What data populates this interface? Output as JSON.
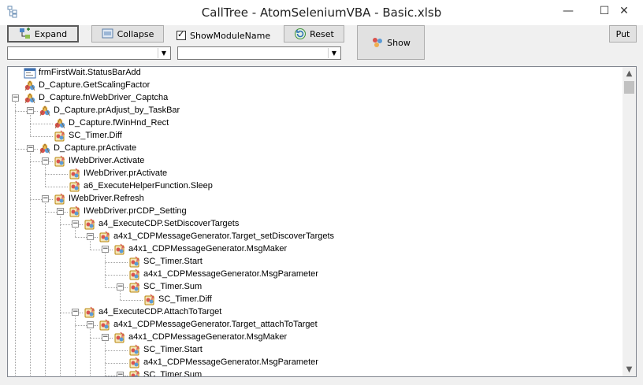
{
  "window": {
    "title": "CallTree - AtomSeleniumVBA - Basic.xlsb",
    "minimize": "—",
    "maximize": "☐",
    "close": "✕"
  },
  "toolbar": {
    "expand_label": "Expand",
    "collapse_label": "Collapse",
    "show_module_name_label": "ShowModuleName",
    "show_module_name_checked": true,
    "reset_label": "Reset",
    "show_label": "Show",
    "put_label": "Put",
    "combo1_value": "",
    "combo2_value": ""
  },
  "icons": {
    "app": "tree-view-icon",
    "expand": "expand-tree-icon",
    "collapse": "collapse-tree-icon",
    "reset": "reset-icon",
    "show": "modules-icon",
    "form_node": "form-icon",
    "module_node": "module-icon",
    "class_node": "class-module-icon"
  },
  "tree": {
    "nodes": [
      {
        "label": "frmFirstWait.StatusBarAdd",
        "depth": 0,
        "icon": "form",
        "expander": "none"
      },
      {
        "label": "D_Capture.GetScalingFactor",
        "depth": 0,
        "icon": "module",
        "expander": "none"
      },
      {
        "label": "D_Capture.fnWebDriver_Captcha",
        "depth": 0,
        "icon": "module",
        "expander": "minus"
      },
      {
        "label": "D_Capture.prAdjust_by_TaskBar",
        "depth": 1,
        "icon": "module",
        "expander": "minus"
      },
      {
        "label": "D_Capture.fWinHnd_Rect",
        "depth": 2,
        "icon": "module",
        "expander": "none"
      },
      {
        "label": "SC_Timer.Diff",
        "depth": 2,
        "icon": "class",
        "expander": "none"
      },
      {
        "label": "D_Capture.prActivate",
        "depth": 1,
        "icon": "module",
        "expander": "minus"
      },
      {
        "label": "IWebDriver.Activate",
        "depth": 2,
        "icon": "class",
        "expander": "minus"
      },
      {
        "label": "IWebDriver.prActivate",
        "depth": 3,
        "icon": "class",
        "expander": "none"
      },
      {
        "label": "a6_ExecuteHelperFunction.Sleep",
        "depth": 3,
        "icon": "class",
        "expander": "none"
      },
      {
        "label": "IWebDriver.Refresh",
        "depth": 2,
        "icon": "class",
        "expander": "minus"
      },
      {
        "label": "IWebDriver.prCDP_Setting",
        "depth": 3,
        "icon": "class",
        "expander": "minus"
      },
      {
        "label": "a4_ExecuteCDP.SetDiscoverTargets",
        "depth": 4,
        "icon": "class",
        "expander": "minus"
      },
      {
        "label": "a4x1_CDPMessageGenerator.Target_setDiscoverTargets",
        "depth": 5,
        "icon": "class",
        "expander": "minus"
      },
      {
        "label": "a4x1_CDPMessageGenerator.MsgMaker",
        "depth": 6,
        "icon": "class",
        "expander": "minus"
      },
      {
        "label": "SC_Timer.Start",
        "depth": 7,
        "icon": "class",
        "expander": "none"
      },
      {
        "label": "a4x1_CDPMessageGenerator.MsgParameter",
        "depth": 7,
        "icon": "class",
        "expander": "none"
      },
      {
        "label": "SC_Timer.Sum",
        "depth": 7,
        "icon": "class",
        "expander": "minus"
      },
      {
        "label": "SC_Timer.Diff",
        "depth": 8,
        "icon": "class",
        "expander": "none"
      },
      {
        "label": "a4_ExecuteCDP.AttachToTarget",
        "depth": 4,
        "icon": "class",
        "expander": "minus"
      },
      {
        "label": "a4x1_CDPMessageGenerator.Target_attachToTarget",
        "depth": 5,
        "icon": "class",
        "expander": "minus"
      },
      {
        "label": "a4x1_CDPMessageGenerator.MsgMaker",
        "depth": 6,
        "icon": "class",
        "expander": "minus"
      },
      {
        "label": "SC_Timer.Start",
        "depth": 7,
        "icon": "class",
        "expander": "none"
      },
      {
        "label": "a4x1_CDPMessageGenerator.MsgParameter",
        "depth": 7,
        "icon": "class",
        "expander": "none"
      },
      {
        "label": "SC_Timer.Sum",
        "depth": 7,
        "icon": "class",
        "expander": "minus"
      }
    ]
  },
  "scrollbar": {
    "up": "▲",
    "down": "▼"
  }
}
